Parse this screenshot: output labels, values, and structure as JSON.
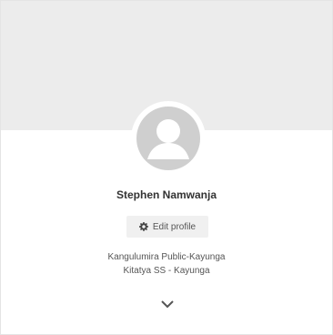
{
  "profile": {
    "name": "Stephen Namwanja",
    "edit_label": "Edit profile",
    "schools": [
      "Kangulumira Public-Kayunga",
      "Kitatya SS - Kayunga"
    ]
  },
  "icons": {
    "avatar": "user-avatar-placeholder",
    "edit": "gear-icon",
    "expand": "chevron-down-icon"
  },
  "colors": {
    "cover": "#ececec",
    "avatar": "#cfcfcf",
    "button_bg": "#f0f0f0"
  }
}
